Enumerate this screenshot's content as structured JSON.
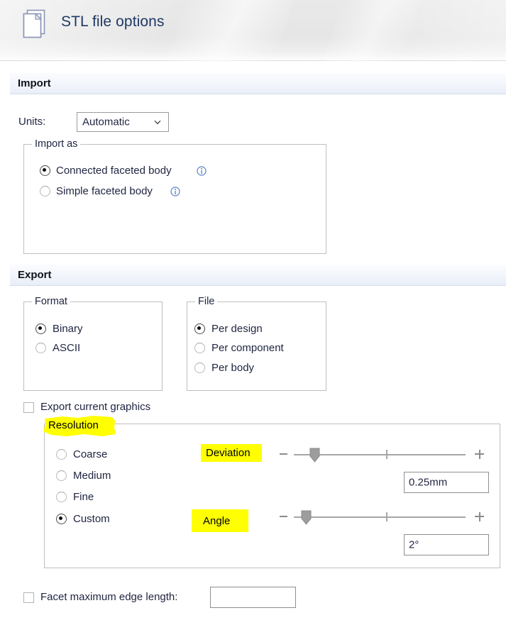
{
  "window": {
    "title": "STL file options",
    "icon": "document-pages-icon"
  },
  "sections": {
    "import": {
      "title": "Import",
      "units_label": "Units:",
      "units_value": "Automatic",
      "units_options": [
        "Automatic"
      ],
      "import_as": {
        "legend": "Import as",
        "options": [
          {
            "label": "Connected faceted body",
            "selected": true,
            "info": true
          },
          {
            "label": "Simple faceted body",
            "selected": false,
            "info": true
          }
        ]
      }
    },
    "export": {
      "title": "Export",
      "format": {
        "legend": "Format",
        "options": [
          {
            "label": "Binary",
            "selected": true
          },
          {
            "label": "ASCII",
            "selected": false
          }
        ]
      },
      "file": {
        "legend": "File",
        "options": [
          {
            "label": "Per design",
            "selected": true
          },
          {
            "label": "Per component",
            "selected": false
          },
          {
            "label": "Per body",
            "selected": false
          }
        ]
      },
      "export_current_graphics": {
        "label": "Export current graphics",
        "checked": false
      },
      "resolution": {
        "legend": "Resolution",
        "legend_highlighted": true,
        "options": [
          {
            "label": "Coarse",
            "selected": false
          },
          {
            "label": "Medium",
            "selected": false
          },
          {
            "label": "Fine",
            "selected": false
          },
          {
            "label": "Custom",
            "selected": true
          }
        ],
        "deviation": {
          "label": "Deviation",
          "label_highlighted": true,
          "value": "0.25mm",
          "slider_percent": 25,
          "minus_label": "−",
          "plus_label": "+"
        },
        "angle": {
          "label": "Angle",
          "label_highlighted": true,
          "value": "2°",
          "slider_percent": 19,
          "minus_label": "−",
          "plus_label": "+"
        }
      },
      "facet_max_edge_length": {
        "label": "Facet maximum edge length:",
        "checked": false,
        "value": ""
      }
    }
  },
  "colors": {
    "highlight": "#ffff00",
    "title_text": "#1f3864",
    "section_band": "#eef3fb",
    "info_icon": "#5b7fc7"
  }
}
